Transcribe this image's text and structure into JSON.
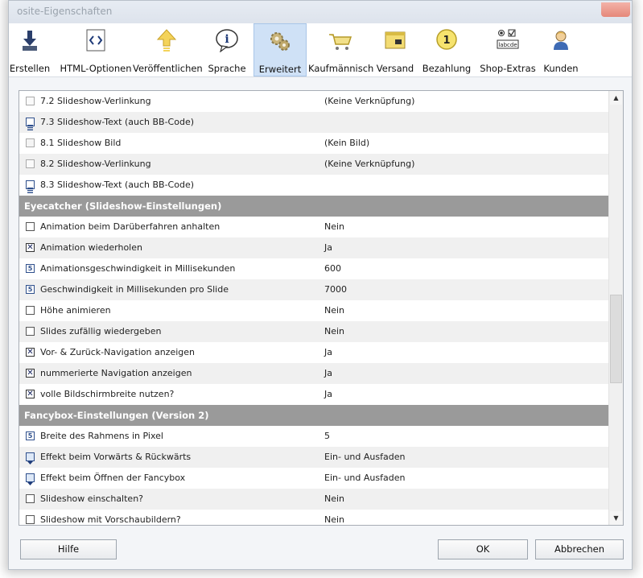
{
  "window": {
    "title": "osite-Eigenschaften"
  },
  "toolbar": {
    "items": [
      {
        "label": "Erstellen",
        "icon": "download-icon"
      },
      {
        "label": "HTML-Optionen",
        "icon": "code-icon"
      },
      {
        "label": "Veröffentlichen",
        "icon": "upload-arrow-icon"
      },
      {
        "label": "Sprache",
        "icon": "info-bubble-icon"
      },
      {
        "label": "Erweitert",
        "icon": "gears-icon",
        "active": true
      },
      {
        "label": "Kaufmännisch",
        "icon": "cart-icon"
      },
      {
        "label": "Versand",
        "icon": "package-icon"
      },
      {
        "label": "Bezahlung",
        "icon": "coin-icon"
      },
      {
        "label": "Shop-Extras",
        "icon": "form-controls-icon"
      },
      {
        "label": "Kunden",
        "icon": "customer-icon"
      }
    ]
  },
  "grid": {
    "rows": [
      {
        "type": "prop",
        "icon": "link",
        "label": "7.2 Slideshow-Verlinkung",
        "value": "(Keine Verknüpfung)"
      },
      {
        "type": "prop",
        "icon": "list",
        "label": "7.3 Slideshow-Text (auch BB-Code)",
        "value": ""
      },
      {
        "type": "prop",
        "icon": "image",
        "label": "8.1 Slideshow Bild",
        "value": "(Kein Bild)"
      },
      {
        "type": "prop",
        "icon": "link",
        "label": "8.2 Slideshow-Verlinkung",
        "value": "(Keine Verknüpfung)"
      },
      {
        "type": "prop",
        "icon": "list",
        "label": "8.3 Slideshow-Text (auch BB-Code)",
        "value": ""
      },
      {
        "type": "section",
        "label": "Eyecatcher (Slideshow-Einstellungen)"
      },
      {
        "type": "prop",
        "icon": "checkbox",
        "label": "Animation beim Darüberfahren anhalten",
        "value": "Nein"
      },
      {
        "type": "prop",
        "icon": "checked",
        "label": "Animation wiederholen",
        "value": "Ja"
      },
      {
        "type": "prop",
        "icon": "number",
        "label": "Animationsgeschwindigkeit in Millisekunden",
        "value": "600"
      },
      {
        "type": "prop",
        "icon": "number",
        "label": "Geschwindigkeit in Millisekunden pro Slide",
        "value": "7000"
      },
      {
        "type": "prop",
        "icon": "checkbox",
        "label": "Höhe animieren",
        "value": "Nein"
      },
      {
        "type": "prop",
        "icon": "checkbox",
        "label": "Slides zufällig wiedergeben",
        "value": "Nein"
      },
      {
        "type": "prop",
        "icon": "checked",
        "label": "Vor- & Zurück-Navigation anzeigen",
        "value": "Ja"
      },
      {
        "type": "prop",
        "icon": "checked",
        "label": "nummerierte Navigation anzeigen",
        "value": "Ja"
      },
      {
        "type": "prop",
        "icon": "checked",
        "label": "volle Bildschirmbreite nutzen?",
        "value": "Ja"
      },
      {
        "type": "section",
        "label": "Fancybox-Einstellungen (Version 2)"
      },
      {
        "type": "prop",
        "icon": "number",
        "label": "Breite des Rahmens in Pixel",
        "value": "5"
      },
      {
        "type": "prop",
        "icon": "dropdown",
        "label": "Effekt beim Vorwärts & Rückwärts",
        "value": "Ein- und Ausfaden"
      },
      {
        "type": "prop",
        "icon": "dropdown",
        "label": "Effekt beim Öffnen der Fancybox",
        "value": "Ein- und Ausfaden"
      },
      {
        "type": "prop",
        "icon": "checkbox",
        "label": "Slideshow einschalten?",
        "value": "Nein"
      },
      {
        "type": "prop",
        "icon": "checkbox",
        "label": "Slideshow mit Vorschaubildern?",
        "value": "Nein"
      }
    ],
    "scroll": {
      "position": 0.6
    }
  },
  "buttons": {
    "help": "Hilfe",
    "ok": "OK",
    "cancel": "Abbrechen"
  }
}
